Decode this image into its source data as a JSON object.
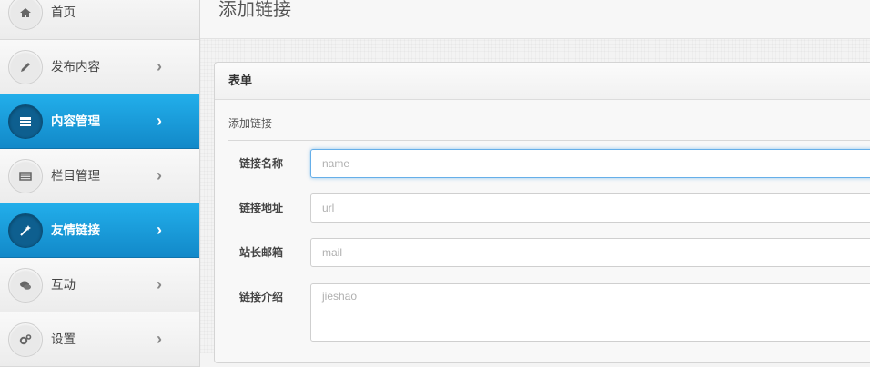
{
  "sidebar": {
    "items": [
      {
        "label": "首页",
        "icon": "home-icon",
        "active": false,
        "has_chevron": false
      },
      {
        "label": "发布内容",
        "icon": "pencil-icon",
        "active": false,
        "has_chevron": true
      },
      {
        "label": "内容管理",
        "icon": "list-icon",
        "active": true,
        "has_chevron": true
      },
      {
        "label": "栏目管理",
        "icon": "columns-icon",
        "active": false,
        "has_chevron": true
      },
      {
        "label": "友情链接",
        "icon": "magic-wand-icon",
        "active": true,
        "has_chevron": true
      },
      {
        "label": "互动",
        "icon": "comments-icon",
        "active": false,
        "has_chevron": true
      },
      {
        "label": "设置",
        "icon": "cogs-icon",
        "active": false,
        "has_chevron": true
      }
    ],
    "chevron": "›"
  },
  "page": {
    "title": "添加链接"
  },
  "panel": {
    "heading": "表单",
    "legend": "添加链接",
    "fields": [
      {
        "label": "链接名称",
        "placeholder": "name",
        "focused": true
      },
      {
        "label": "链接地址",
        "placeholder": "url",
        "focused": false
      },
      {
        "label": "站长邮箱",
        "placeholder": "mail",
        "focused": false
      }
    ],
    "textarea": {
      "label": "链接介绍",
      "placeholder": "jieshao"
    }
  },
  "colors": {
    "active_bg": "#1a9bdb",
    "focus_border": "#66afe9"
  }
}
